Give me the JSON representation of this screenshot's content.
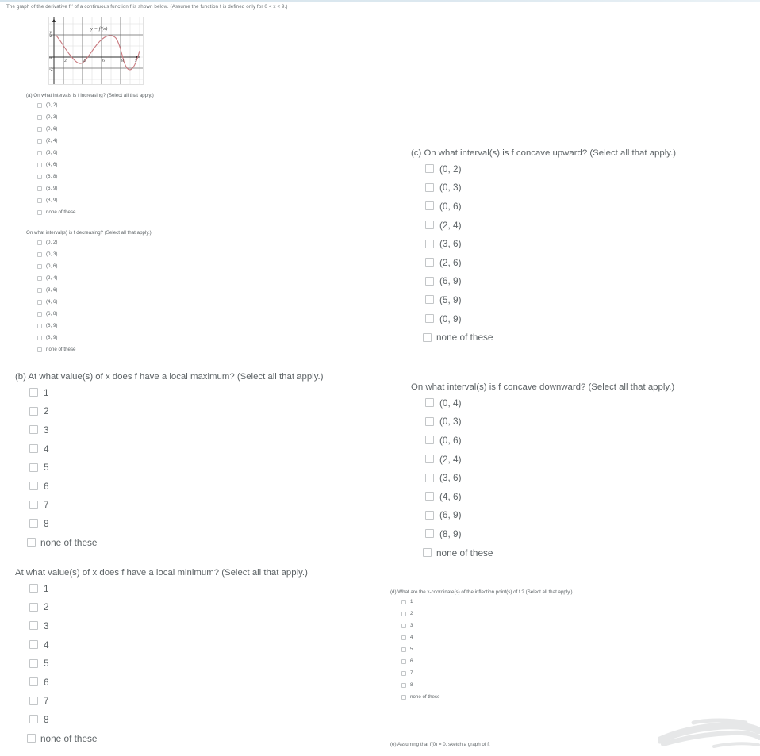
{
  "stem": {
    "text": "The graph of the derivative f ′ of a continuous function f is shown below. (Assume the function f is defined only for 0 < x < 9.)"
  },
  "graph": {
    "curve_label": "y = f′(x)",
    "y_axis_label": "y",
    "x_axis_label": "x",
    "x_ticks": [
      "0",
      "2",
      "4",
      "6",
      "8"
    ],
    "y_ticks": [
      "2",
      "-2"
    ],
    "curve_color": "#c9797f",
    "grid_color": "#d8d8d8",
    "axis_color": "#3a3a3a"
  },
  "questions": {
    "a_increasing": {
      "title": "(a) On what intervals is f increasing? (Select all that apply.)",
      "options": [
        "(0, 2)",
        "(0, 3)",
        "(0, 6)",
        "(2, 4)",
        "(3, 6)",
        "(4, 6)",
        "(6, 8)",
        "(6, 9)",
        "(8, 9)",
        "none of these"
      ]
    },
    "a_decreasing": {
      "title": "On what interval(s) is f decreasing? (Select all that apply.)",
      "options": [
        "(0, 2)",
        "(0, 3)",
        "(0, 6)",
        "(2, 4)",
        "(3, 6)",
        "(4, 6)",
        "(6, 8)",
        "(6, 9)",
        "(8, 9)",
        "none of these"
      ]
    },
    "b_max": {
      "title": "(b) At what value(s) of x does f have a local maximum? (Select all that apply.)",
      "options": [
        "1",
        "2",
        "3",
        "4",
        "5",
        "6",
        "7",
        "8",
        "none of these"
      ]
    },
    "b_min": {
      "title": "At what value(s) of x does f have a local minimum? (Select all that apply.)",
      "options": [
        "1",
        "2",
        "3",
        "4",
        "5",
        "6",
        "7",
        "8",
        "none of these"
      ]
    },
    "c_up": {
      "title": "(c) On what interval(s) is f concave upward? (Select all that apply.)",
      "options": [
        "(0, 2)",
        "(0, 3)",
        "(0, 6)",
        "(2, 4)",
        "(3, 6)",
        "(2, 6)",
        "(6, 9)",
        "(5, 9)",
        "(0, 9)",
        "none of these"
      ]
    },
    "c_down": {
      "title": "On what interval(s) is f concave downward? (Select all that apply.)",
      "options": [
        "(0, 4)",
        "(0, 3)",
        "(0, 6)",
        "(2, 4)",
        "(3, 6)",
        "(4, 6)",
        "(6, 9)",
        "(8, 9)",
        "none of these"
      ]
    },
    "d_inflection": {
      "title": "(d) What are the x-coordinate(s) of the inflection point(s) of f ? (Select all that apply.)",
      "options": [
        "1",
        "2",
        "3",
        "4",
        "5",
        "6",
        "7",
        "8",
        "none of these"
      ]
    },
    "e_sketch": {
      "title": "(e) Assuming that f(0) = 0, sketch a graph of f."
    }
  }
}
